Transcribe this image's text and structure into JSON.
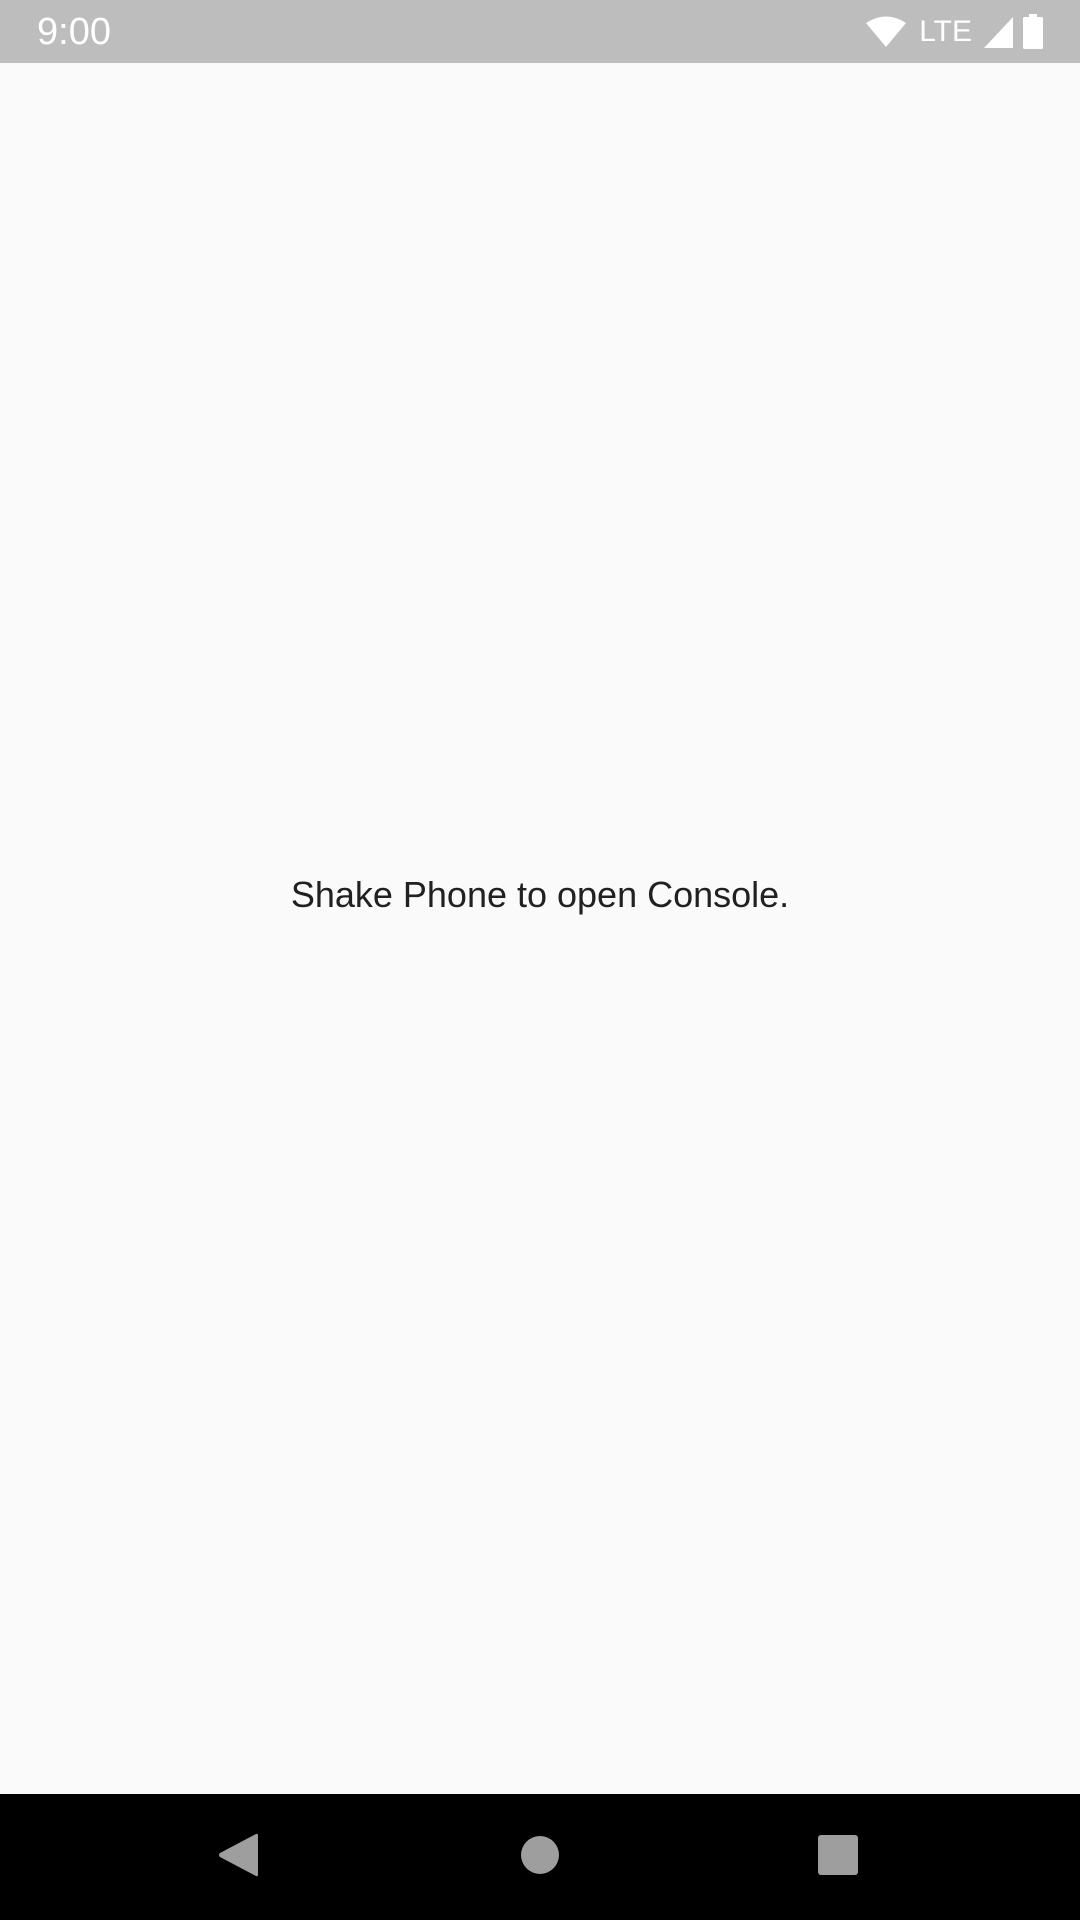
{
  "status_bar": {
    "time": "9:00",
    "network_label": "LTE",
    "icons": [
      "wifi-icon",
      "lte-label",
      "signal-icon",
      "battery-icon"
    ],
    "background_color": "#bdbdbd"
  },
  "main": {
    "message": "Shake Phone to open Console.",
    "background_color": "#fafafa",
    "text_color": "#212121"
  },
  "nav_bar": {
    "buttons": [
      "back-icon",
      "home-icon",
      "recents-icon"
    ],
    "background_color": "#000000",
    "icon_color": "#9e9e9e"
  }
}
